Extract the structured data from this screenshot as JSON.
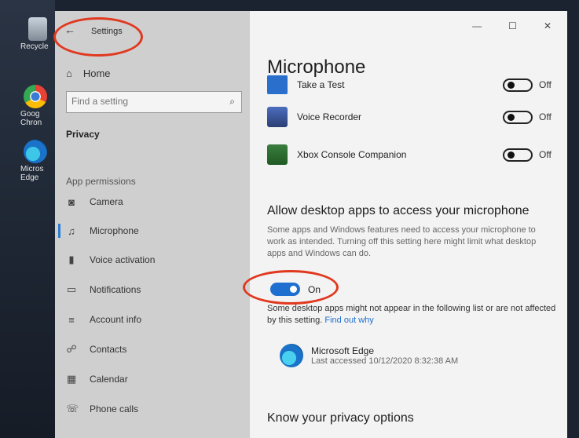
{
  "desktop": {
    "icons": [
      {
        "label": "Recycle"
      },
      {
        "label": "Goog Chron"
      },
      {
        "label": "Micros Edge"
      }
    ]
  },
  "window": {
    "title": "Settings",
    "controls": {
      "minimize": "—",
      "maximize": "☐",
      "close": "✕"
    }
  },
  "sidebar": {
    "home": "Home",
    "search_placeholder": "Find a setting",
    "section": "Privacy",
    "group": "App permissions",
    "items": [
      {
        "label": "Camera",
        "icon": "camera-icon"
      },
      {
        "label": "Microphone",
        "icon": "microphone-icon",
        "selected": true
      },
      {
        "label": "Voice activation",
        "icon": "voice-activation-icon"
      },
      {
        "label": "Notifications",
        "icon": "notifications-icon"
      },
      {
        "label": "Account info",
        "icon": "account-info-icon"
      },
      {
        "label": "Contacts",
        "icon": "contacts-icon"
      },
      {
        "label": "Calendar",
        "icon": "calendar-icon"
      },
      {
        "label": "Phone calls",
        "icon": "phone-calls-icon"
      }
    ]
  },
  "main": {
    "title": "Microphone",
    "apps": [
      {
        "name": "Take a Test",
        "state": "Off"
      },
      {
        "name": "Voice Recorder",
        "state": "Off"
      },
      {
        "name": "Xbox Console Companion",
        "state": "Off"
      }
    ],
    "desktop_section": {
      "heading": "Allow desktop apps to access your microphone",
      "description": "Some apps and Windows features need to access your microphone to work as intended. Turning off this setting here might limit what desktop apps and Windows can do.",
      "toggle_state": "On",
      "note": "Some desktop apps might not appear in the following list or are not affected by this setting.",
      "note_link": "Find out why",
      "entry": {
        "name": "Microsoft Edge",
        "last_accessed": "Last accessed 10/12/2020 8:32:38 AM"
      }
    },
    "footer_heading": "Know your privacy options"
  },
  "annotations": {
    "color": "#e0391f"
  }
}
